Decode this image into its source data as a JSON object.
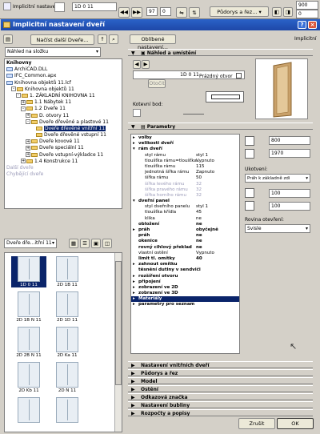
{
  "toolbar": {
    "default_settings_label": "Implicitní nastavení:",
    "id_value": "1D 0 11",
    "layer_label": "Půdorys a řez...",
    "n1": "97",
    "n2": "0",
    "r1": "900",
    "r2": "0"
  },
  "window": {
    "title": "Implicitní nastavení dveří"
  },
  "left": {
    "load_button": "Načíst další Dveře...",
    "view_select": "Náhled na složku",
    "tree": [
      {
        "t": "Knihovny",
        "lvl": 0,
        "type": "header"
      },
      {
        "t": "ArchiCAD.DLL",
        "lvl": 0,
        "type": "file"
      },
      {
        "t": "IFC_Common.apx",
        "lvl": 0,
        "type": "file"
      },
      {
        "t": "Knihovna objektů 11.lcf",
        "lvl": 0,
        "type": "file"
      },
      {
        "t": "Knihovna objektů 11",
        "lvl": 1,
        "type": "folder",
        "pm": "-"
      },
      {
        "t": "1. ZÁKLADNÍ KNIHOVNA 11",
        "lvl": 2,
        "type": "folder",
        "pm": "-"
      },
      {
        "t": "1.1 Nábytek 11",
        "lvl": 3,
        "type": "folder",
        "pm": "+"
      },
      {
        "t": "1.2 Dveře 11",
        "lvl": 3,
        "type": "folder",
        "pm": "-"
      },
      {
        "t": "D. otvory 11",
        "lvl": 4,
        "type": "folder",
        "pm": "+"
      },
      {
        "t": "Dveře dřevěné a plastové 11",
        "lvl": 4,
        "type": "folder",
        "pm": "-"
      },
      {
        "t": "Dveře dřevěné vnitřní 11",
        "lvl": 5,
        "type": "folder",
        "pm": "",
        "sel": true
      },
      {
        "t": "Dveře dřevěné vstupní 11",
        "lvl": 5,
        "type": "folder",
        "pm": ""
      },
      {
        "t": "Dveře kovové 11",
        "lvl": 4,
        "type": "folder",
        "pm": "+"
      },
      {
        "t": "Dveře speciální 11",
        "lvl": 4,
        "type": "folder",
        "pm": "+"
      },
      {
        "t": "Dveře vstupní-výkladce 11",
        "lvl": 4,
        "type": "folder",
        "pm": "+"
      },
      {
        "t": "1.4 Konstrukce 11",
        "lvl": 3,
        "type": "folder",
        "pm": "+"
      },
      {
        "t": "Další dveře",
        "lvl": 0,
        "type": "grey"
      },
      {
        "t": "Chybějící dveře",
        "lvl": 0,
        "type": "grey"
      }
    ],
    "folder_select": "Dveře dře...itřní 11",
    "thumbs": [
      "1D 0 11",
      "2D 1B 11",
      "2D 1B N 11",
      "2D 1D 11",
      "2D 2B N 11",
      "2D Ka 11",
      "2D Kb 11",
      "2D N 11",
      "",
      ""
    ]
  },
  "right": {
    "fav_button": "Oblíbené nastavení...",
    "default_label": "Implicitní",
    "preview_section": "Náhled a umístění",
    "id_value": "1D 0 11",
    "empty_opening": "Prázdný otvor",
    "otocit": "Otočit",
    "anchor_label": "Kotevní bod:",
    "params_section": "Parametry",
    "params": [
      {
        "k": "volby",
        "v": "",
        "ind": 0,
        "b": true,
        "arr": "▸"
      },
      {
        "k": "velikosti dveří",
        "v": "",
        "ind": 0,
        "b": true,
        "arr": "▸"
      },
      {
        "k": "rám dveří",
        "v": "",
        "ind": 0,
        "b": true,
        "arr": "▾"
      },
      {
        "k": "styl rámu",
        "v": "styl 1",
        "ind": 1
      },
      {
        "k": "tloušťka rámu=tloušťka...",
        "v": "Vypnuto",
        "ind": 1
      },
      {
        "k": "tloušťka rámu",
        "v": "115",
        "ind": 1
      },
      {
        "k": "jednotná šířka rámu",
        "v": "Zapnuto",
        "ind": 1
      },
      {
        "k": "šířka rámu",
        "v": "50",
        "ind": 1
      },
      {
        "k": "šířka levého rámu",
        "v": "32",
        "ind": 1,
        "g": true
      },
      {
        "k": "šířka pravého rámu",
        "v": "32",
        "ind": 1,
        "g": true
      },
      {
        "k": "šířka horního rámu",
        "v": "32",
        "ind": 1,
        "g": true
      },
      {
        "k": "dveřní panel",
        "v": "",
        "ind": 0,
        "b": true,
        "arr": "▾"
      },
      {
        "k": "styl dveřního panelu",
        "v": "styl 1",
        "ind": 1
      },
      {
        "k": "tloušťka křídla",
        "v": "45",
        "ind": 1
      },
      {
        "k": "klika",
        "v": "ne",
        "ind": 1
      },
      {
        "k": "obložení",
        "v": "ne",
        "ind": 0,
        "b": true
      },
      {
        "k": "práh",
        "v": "obyčejně",
        "ind": 0,
        "b": true,
        "arr": "▸"
      },
      {
        "k": "práh",
        "v": "ne",
        "ind": 0,
        "b": true
      },
      {
        "k": "okenice",
        "v": "ne",
        "ind": 0,
        "b": true
      },
      {
        "k": "rovný cihlový překlad",
        "v": "ne",
        "ind": 0,
        "b": true
      },
      {
        "k": "vlastní ostění",
        "v": "Vypnuto",
        "ind": 0
      },
      {
        "k": "limit tl. omítky",
        "v": "40",
        "ind": 0,
        "b": true
      },
      {
        "k": "zahnout omítku",
        "v": "",
        "ind": 0,
        "b": true,
        "arr": "▸"
      },
      {
        "k": "těsnění dutiny v sendviči",
        "v": "",
        "ind": 0,
        "b": true
      },
      {
        "k": "rozšíření otvoru",
        "v": "",
        "ind": 0,
        "b": true,
        "arr": "▸"
      },
      {
        "k": "připojení",
        "v": "",
        "ind": 0,
        "b": true,
        "arr": "▸"
      },
      {
        "k": "zobrazení ve 2D",
        "v": "",
        "ind": 0,
        "b": true,
        "arr": "▸"
      },
      {
        "k": "zobrazení ve 3D",
        "v": "",
        "ind": 0,
        "b": true,
        "arr": "▸"
      },
      {
        "k": "Materiály",
        "v": "",
        "ind": 0,
        "b": true,
        "arr": "▸",
        "sel": true
      },
      {
        "k": "parametry pro seznam",
        "v": "",
        "ind": 0,
        "b": true,
        "arr": "▸"
      }
    ],
    "width": "800",
    "height": "1970",
    "anchoring_label": "Ukotvení:",
    "anchoring_value": "Práh k základně zdi",
    "v1": "100",
    "v2": "100",
    "opening_plane_label": "Rovina otevření:",
    "opening_plane_value": "Svisle",
    "sections": [
      "Nastavení vnitřních dveří",
      "Půdorys a řez",
      "Model",
      "Ostění",
      "Odkazová značka",
      "Nastavení bubliny",
      "Rozpočty a popisy"
    ],
    "cancel": "Zrušit",
    "ok": "OK"
  }
}
